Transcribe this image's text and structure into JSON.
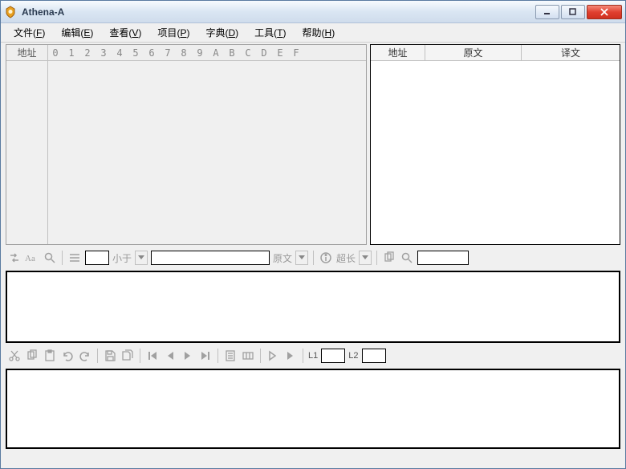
{
  "window": {
    "title": "Athena-A"
  },
  "menu": {
    "file": "文件",
    "file_k": "F",
    "edit": "编辑",
    "edit_k": "E",
    "view": "查看",
    "view_k": "V",
    "project": "项目",
    "project_k": "P",
    "dict": "字典",
    "dict_k": "D",
    "tools": "工具",
    "tools_k": "T",
    "help": "帮助",
    "help_k": "H"
  },
  "hex": {
    "addr_label": "地址",
    "cols": [
      "0",
      "1",
      "2",
      "3",
      "4",
      "5",
      "6",
      "7",
      "8",
      "9",
      "A",
      "B",
      "C",
      "D",
      "E",
      "F"
    ]
  },
  "trans": {
    "col_addr": "地址",
    "col_src": "原文",
    "col_dst": "译文"
  },
  "toolbar1": {
    "lessthan": "小于",
    "source": "原文",
    "overlong": "超长"
  },
  "toolbar2": {
    "l1": "L1",
    "l2": "L2"
  }
}
